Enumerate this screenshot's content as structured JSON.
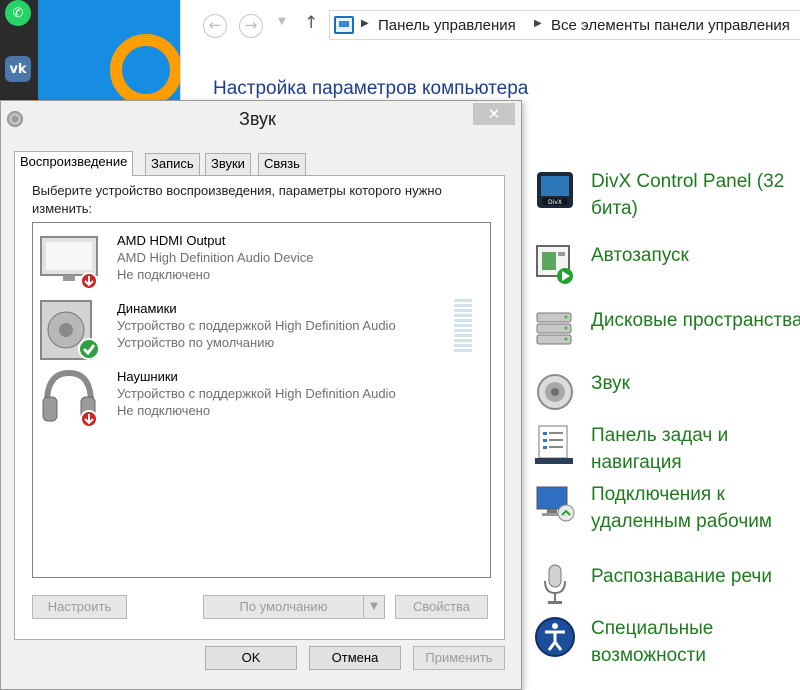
{
  "control_panel": {
    "breadcrumb": [
      "Панель управления",
      "Все элементы панели управления"
    ],
    "heading": "Настройка параметров компьютера",
    "items": [
      {
        "label": "DivX Control Panel (32 бита)",
        "icon": "divx-icon"
      },
      {
        "label": "Автозапуск",
        "icon": "autoplay-icon"
      },
      {
        "label": "Дисковые пространства",
        "icon": "storage-spaces-icon"
      },
      {
        "label": "Звук",
        "icon": "speaker-icon"
      },
      {
        "label": "Панель задач и навигация",
        "icon": "taskbar-icon"
      },
      {
        "label": "Подключения к удаленным рабочим",
        "icon": "remote-desktop-icon"
      },
      {
        "label": "Распознавание речи",
        "icon": "microphone-icon"
      },
      {
        "label": "Специальные возможности",
        "icon": "accessibility-icon"
      }
    ]
  },
  "dialog": {
    "title": "Звук",
    "close_glyph": "✕",
    "tabs": [
      "Воспроизведение",
      "Запись",
      "Звуки",
      "Связь"
    ],
    "active_tab": 0,
    "description": "Выберите устройство воспроизведения, параметры которого нужно изменить:",
    "devices": [
      {
        "name": "AMD HDMI Output",
        "line2": "AMD High Definition Audio Device",
        "line3": "Не подключено",
        "status": "disconnected",
        "icon": "monitor-icon"
      },
      {
        "name": "Динамики",
        "line2": "Устройство с поддержкой High Definition Audio",
        "line3": "Устройство по умолчанию",
        "status": "default",
        "icon": "speaker-icon"
      },
      {
        "name": "Наушники",
        "line2": "Устройство с поддержкой High Definition Audio",
        "line3": "Не подключено",
        "status": "disconnected",
        "icon": "headphones-icon"
      }
    ],
    "buttons": {
      "configure": "Настроить",
      "set_default": "По умолчанию",
      "properties": "Свойства",
      "ok": "OK",
      "cancel": "Отмена",
      "apply": "Применить"
    }
  },
  "colors": {
    "link_green": "#1e7b1e",
    "heading_blue": "#1e3d8f",
    "dialog_bg": "#f0f0f0"
  }
}
